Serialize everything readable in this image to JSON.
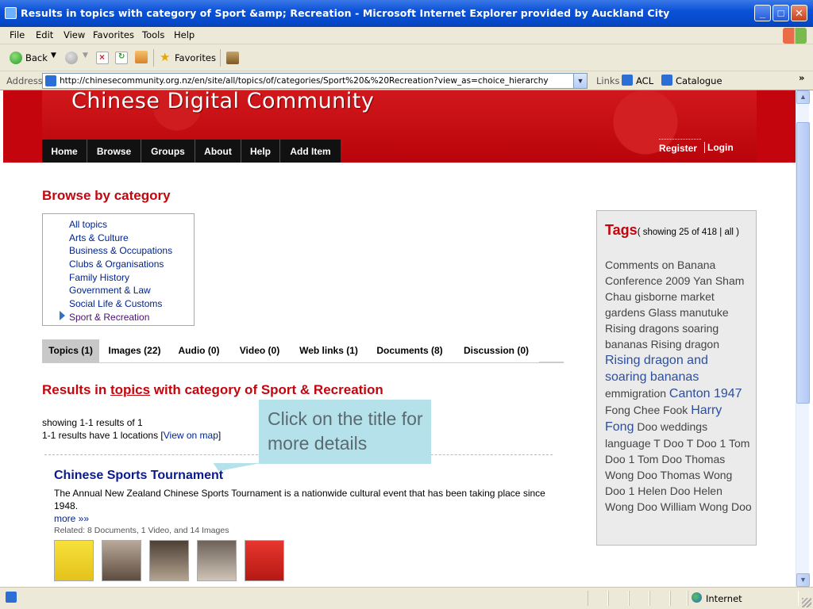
{
  "window": {
    "title": "Results in topics with category of Sport &amp; Recreation - Microsoft Internet Explorer provided by Auckland City",
    "minimize": "_",
    "maximize": "□",
    "close": "✕"
  },
  "menu": [
    "File",
    "Edit",
    "View",
    "Favorites",
    "Tools",
    "Help"
  ],
  "toolbar": {
    "back": "Back",
    "favorites": "Favorites"
  },
  "address": {
    "label": "Address",
    "url": "http://chinesecommunity.org.nz/en/site/all/topics/of/categories/Sport%20&%20Recreation?view_as=choice_hierarchy",
    "links_label": "Links",
    "links": [
      "ACL",
      "Catalogue"
    ],
    "more": "»"
  },
  "site": {
    "title": "Chinese Digital Community",
    "nav": [
      "Home",
      "Browse",
      "Groups",
      "About",
      "Help",
      "Add Item"
    ],
    "register": "Register",
    "login": "Login"
  },
  "browse": {
    "heading": "Browse by category",
    "categories": [
      "All topics",
      "Arts & Culture",
      "Business & Occupations",
      "Clubs & Organisations",
      "Family History",
      "Government & Law",
      "Social Life & Customs",
      "Sport & Recreation"
    ]
  },
  "tabs": [
    "Topics (1)",
    "Images (22)",
    "Audio (0)",
    "Video (0)",
    "Web links (1)",
    "Documents (8)",
    "Discussion (0)"
  ],
  "results": {
    "heading_pre": "Results in ",
    "heading_link": "topics",
    "heading_post": " with category of Sport & Recreation",
    "showing": "showing 1-1 results of 1",
    "locations_pre": "1-1 results have 1 locations [",
    "map_link": "View on map",
    "locations_post": "]"
  },
  "item": {
    "title": "Chinese Sports Tournament",
    "description": "The Annual New Zealand Chinese Sports Tournament is a nationwide cultural event that has been taking place since 1948.",
    "more": "more »»",
    "related": "Related: 8 Documents, 1 Video, and 14 Images"
  },
  "tooltip": {
    "text": "Click on the title for more details"
  },
  "tags": {
    "heading": "Tags",
    "count_pre": "( showing 25 of 418 | ",
    "all_link": "all",
    "count_post": " )",
    "cloud": [
      {
        "t": "Comments on Banana",
        "lg": false
      },
      {
        "t": "Conference 2009",
        "lg": false
      },
      {
        "t": "Yan Sham Chau",
        "lg": false
      },
      {
        "t": "gisborne",
        "lg": false
      },
      {
        "t": "market gardens",
        "lg": false
      },
      {
        "t": "Glass",
        "lg": false
      },
      {
        "t": "manutuke",
        "lg": false
      },
      {
        "t": "Rising dragons soaring bananas",
        "lg": false
      },
      {
        "t": "Rising dragon",
        "lg": false
      },
      {
        "t": "Rising dragon and soaring bananas",
        "lg": true
      },
      {
        "t": "emmigration",
        "lg": false
      },
      {
        "t": "Canton 1947",
        "lg": true
      },
      {
        "t": "Fong Chee Fook",
        "lg": false
      },
      {
        "t": "Harry Fong",
        "lg": true
      },
      {
        "t": "Doo weddings",
        "lg": false
      },
      {
        "t": "language",
        "lg": false
      },
      {
        "t": "T Doo",
        "lg": false
      },
      {
        "t": "T Doo 1",
        "lg": false
      },
      {
        "t": "Tom Doo 1",
        "lg": false
      },
      {
        "t": "Tom Doo",
        "lg": false
      },
      {
        "t": "Thomas Wong Doo",
        "lg": false
      },
      {
        "t": "Thomas Wong Doo 1",
        "lg": false
      },
      {
        "t": "Helen Doo",
        "lg": false
      },
      {
        "t": "Helen Wong Doo",
        "lg": false
      },
      {
        "t": "William Wong Doo",
        "lg": false
      }
    ]
  },
  "status": {
    "zone": "Internet"
  },
  "colors": {
    "brand_red": "#c4050d",
    "link_blue": "#00248d",
    "tooltip_bg": "#b5e1ea",
    "xp_blue": "#0a52d8"
  }
}
